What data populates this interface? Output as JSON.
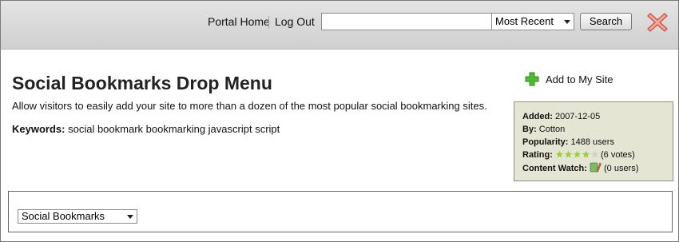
{
  "nav": {
    "portal_home": "Portal Home",
    "log_out": "Log Out"
  },
  "search": {
    "value": "",
    "placeholder": "",
    "sort_selected": "Most Recent",
    "button_label": "Search"
  },
  "page": {
    "title": "Social Bookmarks Drop Menu",
    "description": "Allow visitors to easily add your site to more than a dozen of the most popular social bookmarking sites.",
    "keywords_label": "Keywords:",
    "keywords": "social bookmark bookmarking javascript script",
    "add_to_site": "Add to My Site"
  },
  "info": {
    "added_label": "Added:",
    "added": "2007-12-05",
    "by_label": "By:",
    "by": "Cotton",
    "popularity_label": "Popularity:",
    "popularity": "1488 users",
    "rating_label": "Rating:",
    "rating_stars": 4,
    "rating_max": 5,
    "rating_votes": "(6 votes)",
    "content_watch_label": "Content Watch:",
    "content_watch": "(0 users)"
  },
  "widget": {
    "select_value": "Social Bookmarks"
  },
  "colors": {
    "star_on": "#9ccf3a",
    "star_off": "#d2d2c6",
    "close_red": "#e04a3a",
    "plus_green": "#3fae2a",
    "info_bg": "#e4e5d3"
  }
}
